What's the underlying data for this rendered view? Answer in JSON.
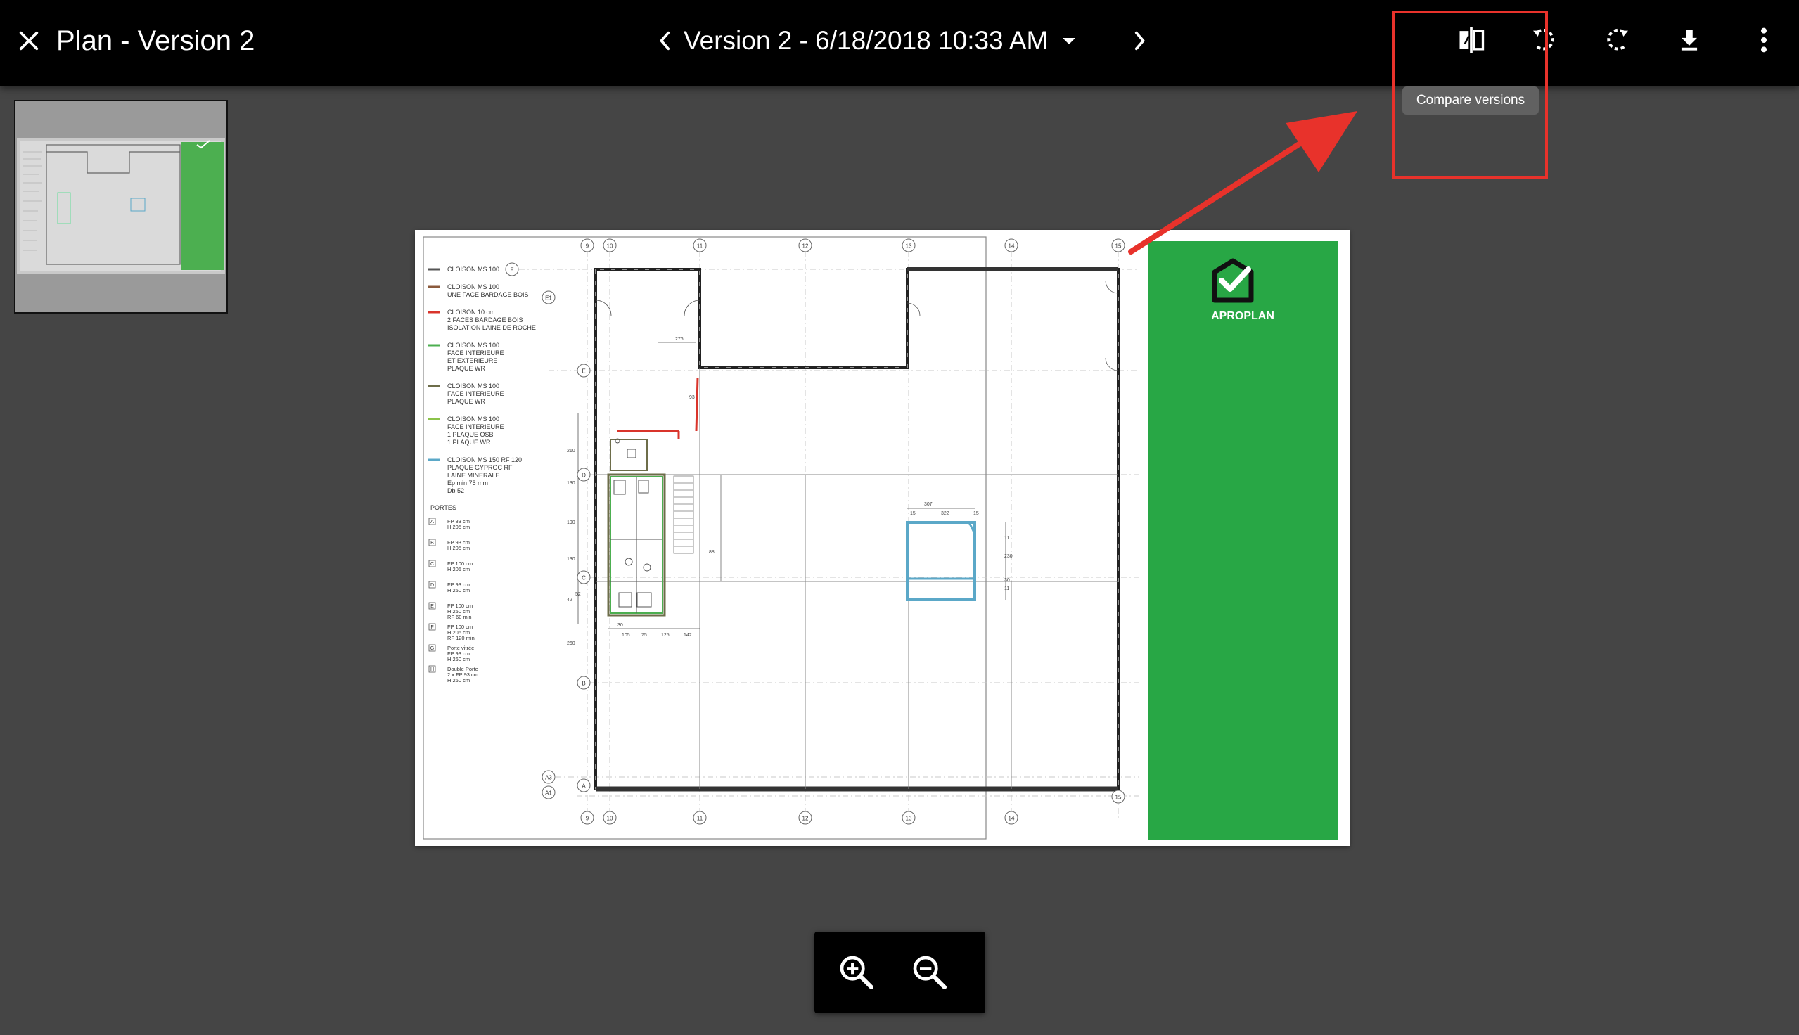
{
  "header": {
    "title": "Plan - Version 2",
    "version_label": "Version 2 - 6/18/2018 10:33 AM",
    "actions": [
      {
        "name": "compare-versions-icon"
      },
      {
        "name": "rotate-left-icon"
      },
      {
        "name": "rotate-right-icon"
      },
      {
        "name": "download-icon"
      },
      {
        "name": "more-vert-icon"
      }
    ]
  },
  "tooltip": {
    "text": "Compare versions"
  },
  "plan": {
    "brand": "APROPLAN",
    "brand_color": "#28a745",
    "legend": [
      {
        "color": "#555555",
        "lines": [
          "CLOISON MS 100"
        ]
      },
      {
        "color": "#8b5a3c",
        "lines": [
          "CLOISON MS 100",
          "UNE FACE BARDAGE BOIS"
        ]
      },
      {
        "color": "#d9342b",
        "lines": [
          "CLOISON 10 cm",
          "2 FACES BARDAGE BOIS",
          "ISOLATION LAINE DE ROCHE"
        ]
      },
      {
        "color": "#4caf50",
        "lines": [
          "CLOISON MS 100",
          "FACE INTERIEURE",
          "ET EXTERIEURE",
          "PLAQUE WR"
        ]
      },
      {
        "color": "#6d6d4a",
        "lines": [
          "CLOISON MS 100",
          "FACE INTERIEURE",
          "PLAQUE WR"
        ]
      },
      {
        "color": "#8bc34a",
        "lines": [
          "CLOISON MS 100",
          "FACE INTERIEURE",
          "1 PLAQUE OSB",
          "1 PLAQUE WR"
        ]
      },
      {
        "color": "#5ba8c8",
        "lines": [
          "CLOISON MS 150 RF 120",
          "PLAQUE GYPROC RF",
          "LAINE MINERALE",
          "Ep min 75 mm",
          "Db 52"
        ]
      }
    ],
    "doors_heading": "PORTES",
    "doors": [
      {
        "key": "A",
        "lines": [
          "FP 83 cm",
          "H 205 cm"
        ]
      },
      {
        "key": "B",
        "lines": [
          "FP 93 cm",
          "H 205 cm"
        ]
      },
      {
        "key": "C",
        "lines": [
          "FP 100 cm",
          "H 205 cm"
        ]
      },
      {
        "key": "D",
        "lines": [
          "FP 93 cm",
          "H 250 cm"
        ]
      },
      {
        "key": "E",
        "lines": [
          "FP 100 cm",
          "H 250 cm",
          "RF 60 min"
        ]
      },
      {
        "key": "F",
        "lines": [
          "FP 100 cm",
          "H 205 cm",
          "RF 120 min"
        ]
      },
      {
        "key": "G",
        "lines": [
          "Porte vitrée",
          "FP 93 cm",
          "H 260 cm"
        ]
      },
      {
        "key": "H",
        "lines": [
          "Double Porte",
          "2 x FP 93 cm",
          "H 260 cm"
        ]
      }
    ],
    "grid_top": [
      "9",
      "10",
      "11",
      "12",
      "13",
      "14",
      "15"
    ],
    "grid_bottom": [
      "9",
      "10",
      "11",
      "12",
      "13",
      "14",
      "15"
    ],
    "grid_left": [
      "F",
      "E1",
      "E",
      "D",
      "C",
      "B",
      "A3",
      "A1",
      "A"
    ],
    "dims": [
      "276",
      "93",
      "210",
      "130",
      "190",
      "130",
      "42",
      "260",
      "30",
      "105",
      "75",
      "125",
      "142",
      "307",
      "322",
      "15",
      "15",
      "11",
      "230",
      "30",
      "11",
      "52",
      "88"
    ]
  },
  "zoom": {
    "in_icon": "zoom-in-icon",
    "out_icon": "zoom-out-icon"
  },
  "annotation_color": "#e8322b"
}
